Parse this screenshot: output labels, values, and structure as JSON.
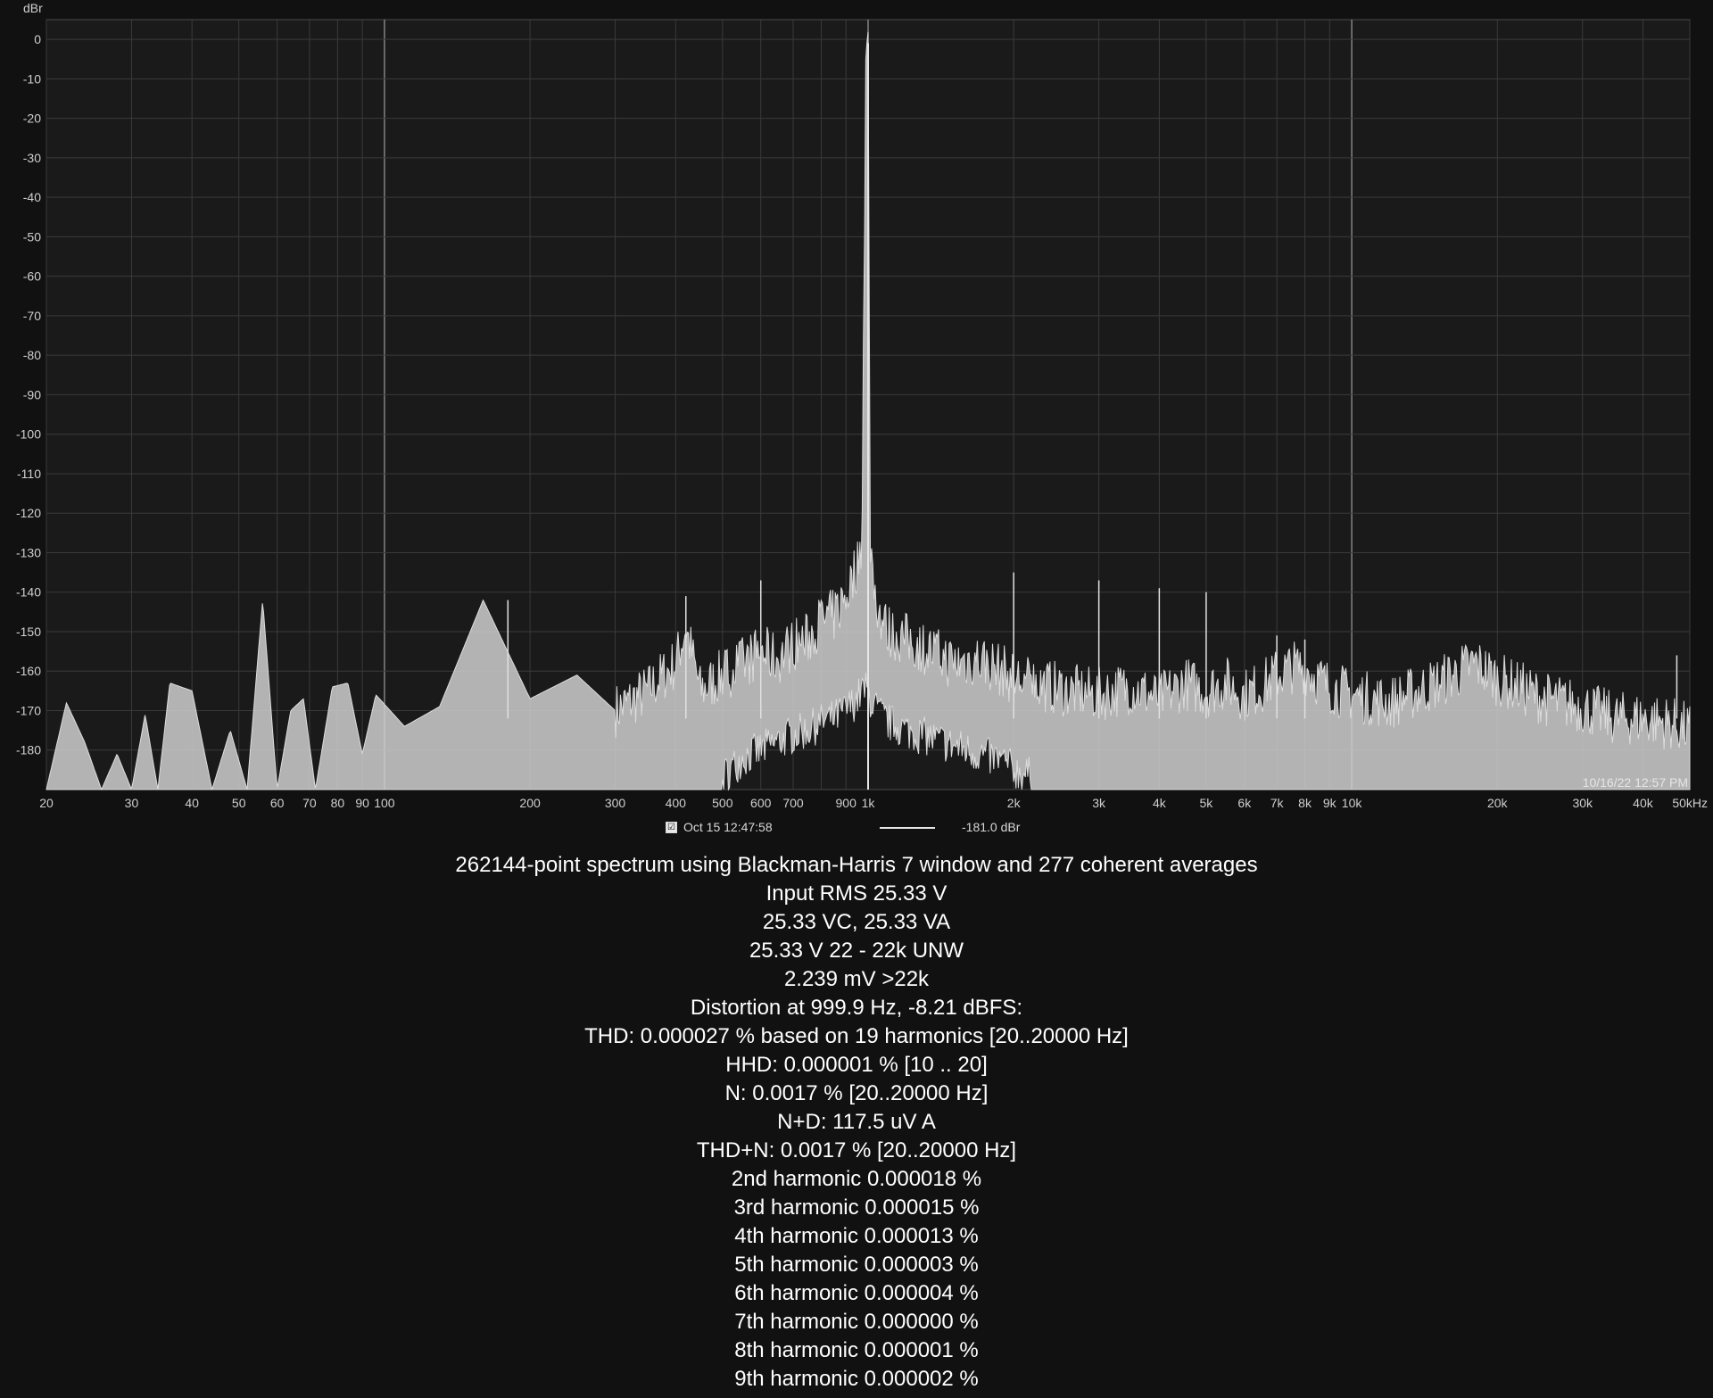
{
  "chart_data": {
    "type": "line",
    "ylabel": "dBr",
    "xscale": "log",
    "xlim": [
      20,
      50000
    ],
    "ylim": [
      -190,
      5
    ],
    "y_ticks": [
      0,
      -10,
      -20,
      -30,
      -40,
      -50,
      -60,
      -70,
      -80,
      -90,
      -100,
      -110,
      -120,
      -130,
      -140,
      -150,
      -160,
      -170,
      -180
    ],
    "x_ticks": [
      {
        "v": 20,
        "label": "20"
      },
      {
        "v": 30,
        "label": "30"
      },
      {
        "v": 40,
        "label": "40"
      },
      {
        "v": 50,
        "label": "50"
      },
      {
        "v": 60,
        "label": "60"
      },
      {
        "v": 70,
        "label": "70"
      },
      {
        "v": 80,
        "label": "80"
      },
      {
        "v": 90,
        "label": "90"
      },
      {
        "v": 100,
        "label": "100"
      },
      {
        "v": 200,
        "label": "200"
      },
      {
        "v": 300,
        "label": "300"
      },
      {
        "v": 400,
        "label": "400"
      },
      {
        "v": 500,
        "label": "500"
      },
      {
        "v": 600,
        "label": "600"
      },
      {
        "v": 700,
        "label": "700"
      },
      {
        "v": 900,
        "label": "900"
      },
      {
        "v": 1000,
        "label": "1k"
      },
      {
        "v": 2000,
        "label": "2k"
      },
      {
        "v": 3000,
        "label": "3k"
      },
      {
        "v": 4000,
        "label": "4k"
      },
      {
        "v": 5000,
        "label": "5k"
      },
      {
        "v": 6000,
        "label": "6k"
      },
      {
        "v": 7000,
        "label": "7k"
      },
      {
        "v": 8000,
        "label": "8k"
      },
      {
        "v": 9000,
        "label": "9k"
      },
      {
        "v": 10000,
        "label": "10k"
      },
      {
        "v": 20000,
        "label": "20k"
      },
      {
        "v": 30000,
        "label": "30k"
      },
      {
        "v": 40000,
        "label": "40k"
      },
      {
        "v": 50000,
        "label": "50kHz"
      }
    ],
    "grid": true,
    "bright_gridlines_hz": [
      100,
      1000,
      10000
    ],
    "series": [
      {
        "color": "#d4d4d4",
        "x": [
          20,
          22,
          24,
          26,
          28,
          30,
          32,
          34,
          36,
          40,
          44,
          48,
          52,
          56,
          60,
          64,
          68,
          72,
          78,
          84,
          90,
          96,
          110,
          130,
          160,
          200,
          250,
          300,
          350,
          400,
          420,
          450,
          500,
          550,
          600,
          650,
          700,
          750,
          800,
          850,
          900,
          950,
          970,
          990,
          1000,
          1010,
          1030,
          1060,
          1100,
          1200,
          1350,
          1500,
          1700,
          1900,
          2000,
          2200,
          2600,
          3000,
          3500,
          4000,
          4500,
          5000,
          5500,
          6000,
          6500,
          7000,
          7500,
          8000,
          8500,
          9000,
          10000,
          12000,
          15000,
          18000,
          20000,
          22000,
          25000,
          30000,
          35000,
          40000,
          45000,
          48000,
          50000
        ],
        "y": [
          -190,
          -168,
          -178,
          -190,
          -181,
          -190,
          -171,
          -190,
          -163,
          -165,
          -190,
          -175,
          -190,
          -142,
          -190,
          -170,
          -167,
          -190,
          -164,
          -163,
          -181,
          -166,
          -174,
          -169,
          -142,
          -167,
          -161,
          -170,
          -165,
          -158,
          -149,
          -165,
          -161,
          -158,
          -155,
          -157,
          -153,
          -152,
          -147,
          -146,
          -141,
          -133,
          -128,
          -1,
          -2,
          -126,
          -139,
          -146,
          -150,
          -152,
          -155,
          -158,
          -157,
          -160,
          -162,
          -163,
          -165,
          -166,
          -164,
          -167,
          -163,
          -165,
          -163,
          -166,
          -164,
          -161,
          -159,
          -159,
          -162,
          -164,
          -166,
          -168,
          -163,
          -158,
          -162,
          -164,
          -167,
          -169,
          -172,
          -172,
          -173,
          -174,
          -175
        ],
        "floor": [
          -190,
          -190,
          -190,
          -190,
          -190,
          -190,
          -190,
          -190,
          -190,
          -190,
          -190,
          -190,
          -190,
          -190,
          -190,
          -190,
          -190,
          -190,
          -190,
          -190,
          -190,
          -190,
          -190,
          -190,
          -190,
          -190,
          -190,
          -190,
          -190,
          -190,
          -190,
          -190,
          -190,
          -185,
          -183,
          -181,
          -179,
          -178,
          -176,
          -175,
          -173,
          -170,
          -168,
          -168,
          -168,
          -170,
          -172,
          -174,
          -176,
          -178,
          -180,
          -182,
          -184,
          -186,
          -188,
          -190,
          -190,
          -190,
          -190,
          -190,
          -190,
          -190,
          -190,
          -190,
          -190,
          -190,
          -190,
          -190,
          -190,
          -190,
          -190,
          -190,
          -190,
          -190,
          -190,
          -190,
          -190,
          -190,
          -190,
          -190,
          -190,
          -190,
          -190
        ],
        "spurs": [
          {
            "x": 180,
            "y": -142
          },
          {
            "x": 420,
            "y": -141
          },
          {
            "x": 600,
            "y": -137
          },
          {
            "x": 2000,
            "y": -135
          },
          {
            "x": 3000,
            "y": -137
          },
          {
            "x": 4000,
            "y": -139
          },
          {
            "x": 5000,
            "y": -140
          },
          {
            "x": 7000,
            "y": -151
          },
          {
            "x": 8000,
            "y": -152
          },
          {
            "x": 47000,
            "y": -156
          }
        ]
      }
    ],
    "timestamp": "10/16/22 12:57 PM",
    "legend": {
      "checkbox": "☑",
      "label": "Oct 15 12:47:58",
      "value": "-181.0 dBr"
    }
  },
  "stats": [
    "262144-point spectrum using Blackman-Harris 7 window and 277 coherent averages",
    "Input RMS 25.33 V",
    "25.33 VC, 25.33 VA",
    "25.33 V 22 - 22k UNW",
    "2.239 mV >22k",
    "Distortion at 999.9 Hz, -8.21 dBFS:",
    "THD: 0.000027 % based on 19 harmonics [20..20000 Hz]",
    "HHD: 0.000001 % [10 .. 20]",
    "N: 0.0017 % [20..20000 Hz]",
    "N+D: 117.5 uV A",
    "THD+N: 0.0017 % [20..20000 Hz]",
    "2nd harmonic 0.000018 %",
    "3rd harmonic 0.000015 %",
    "4th harmonic 0.000013 %",
    "5th harmonic 0.000003 %",
    "6th harmonic 0.000004 %",
    "7th harmonic 0.000000 %",
    "8th harmonic 0.000001 %",
    "9th harmonic 0.000002 %"
  ]
}
